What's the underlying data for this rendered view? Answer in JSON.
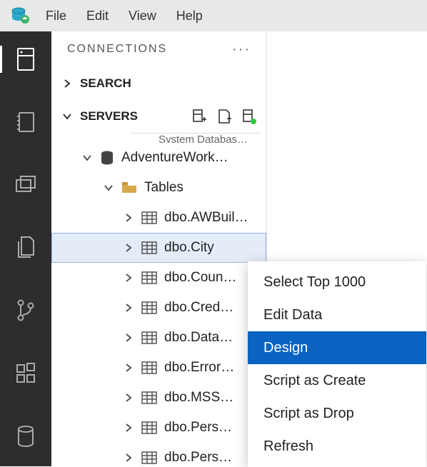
{
  "menubar": {
    "items": [
      "File",
      "Edit",
      "View",
      "Help"
    ]
  },
  "activity": {
    "items": [
      {
        "name": "connections",
        "active": true
      },
      {
        "name": "notebooks",
        "active": false
      },
      {
        "name": "explorer",
        "active": false
      },
      {
        "name": "files",
        "active": false
      },
      {
        "name": "source-control",
        "active": false
      },
      {
        "name": "extensions",
        "active": false
      },
      {
        "name": "database",
        "active": false
      }
    ]
  },
  "sidebar": {
    "title": "CONNECTIONS",
    "search_label": "SEARCH",
    "servers_label": "SERVERS",
    "cut_label": "System Databas…",
    "db_label": "AdventureWork…",
    "tables_label": "Tables",
    "tables": [
      {
        "label": "dbo.AWBuil…",
        "selected": false
      },
      {
        "label": "dbo.City",
        "selected": true
      },
      {
        "label": "dbo.Coun…",
        "selected": false
      },
      {
        "label": "dbo.Cred…",
        "selected": false
      },
      {
        "label": "dbo.Data…",
        "selected": false
      },
      {
        "label": "dbo.Error…",
        "selected": false
      },
      {
        "label": "dbo.MSS…",
        "selected": false
      },
      {
        "label": "dbo.Pers…",
        "selected": false
      },
      {
        "label": "dbo.Pers…",
        "selected": false
      }
    ]
  },
  "context_menu": {
    "items": [
      {
        "label": "Select Top 1000",
        "hover": false
      },
      {
        "label": "Edit Data",
        "hover": false
      },
      {
        "label": "Design",
        "hover": true
      },
      {
        "label": "Script as Create",
        "hover": false
      },
      {
        "label": "Script as Drop",
        "hover": false
      },
      {
        "label": "Refresh",
        "hover": false
      }
    ]
  }
}
